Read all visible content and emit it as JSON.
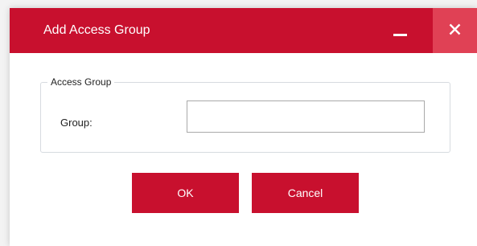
{
  "window": {
    "title": "Add Access Group",
    "minimize_icon": "minimize-icon",
    "close_icon": "close-icon",
    "accent_color": "#c8102e",
    "close_hover_color": "#e04155"
  },
  "form": {
    "groupbox_title": "Access Group",
    "group_label": "Group:",
    "group_value": "",
    "group_placeholder": ""
  },
  "buttons": {
    "ok_label": "OK",
    "cancel_label": "Cancel"
  }
}
